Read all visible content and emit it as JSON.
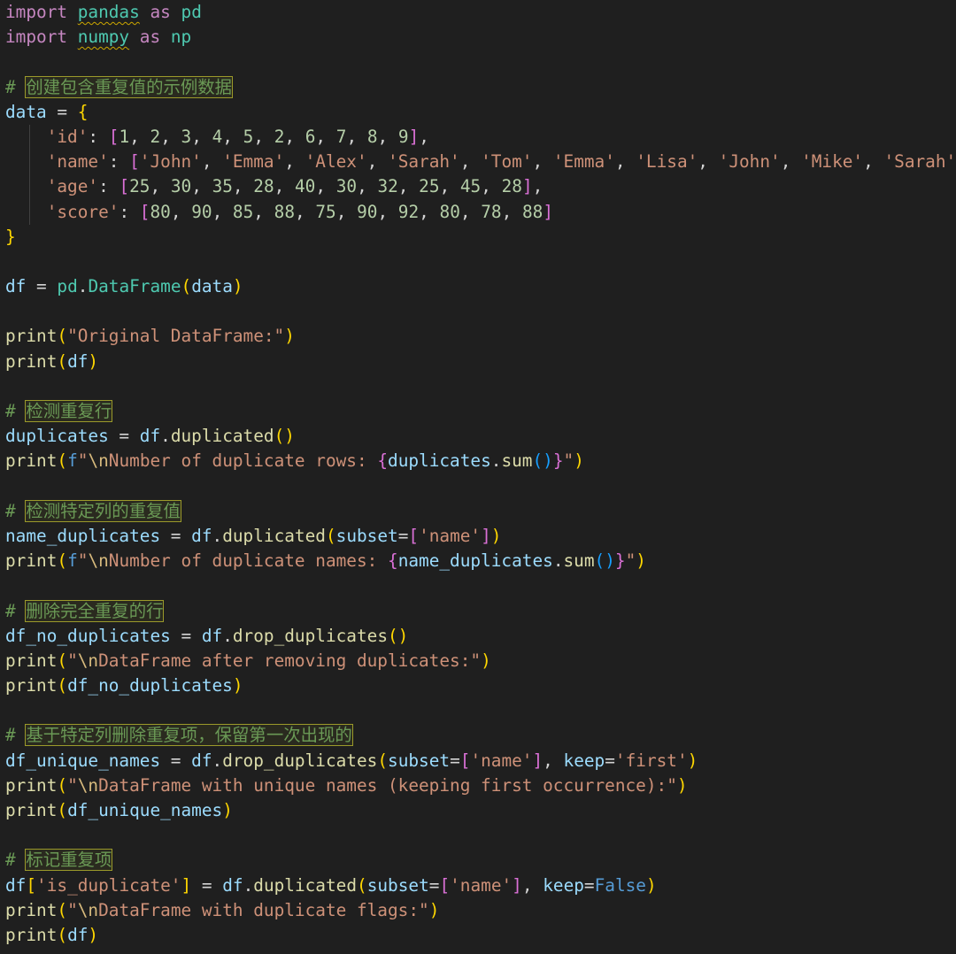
{
  "editor": {
    "language": "python",
    "theme_colors": {
      "background": "#1f1f1f",
      "keyword": "#c586c0",
      "variable": "#9cdcfe",
      "function": "#dcdcaa",
      "class": "#4ec9b0",
      "string": "#ce9178",
      "number": "#b5cea8",
      "comment": "#6a9955",
      "escape": "#d7ba7d",
      "constant": "#569cd6",
      "bracket_level1": "#ffd700",
      "bracket_level2": "#da70d6",
      "bracket_level3": "#179fff",
      "highlight_border": "#9b9a2a",
      "warning_squiggle": "#cca700"
    },
    "lines": [
      [
        [
          "kw",
          "import"
        ],
        [
          "t",
          " "
        ],
        [
          "mod squig",
          "pandas"
        ],
        [
          "t",
          " "
        ],
        [
          "kw",
          "as"
        ],
        [
          "t",
          " "
        ],
        [
          "mod",
          "pd"
        ]
      ],
      [
        [
          "kw",
          "import"
        ],
        [
          "t",
          " "
        ],
        [
          "mod squig",
          "numpy"
        ],
        [
          "t",
          " "
        ],
        [
          "kw",
          "as"
        ],
        [
          "t",
          " "
        ],
        [
          "mod",
          "np"
        ]
      ],
      [],
      [
        [
          "cm",
          "# "
        ],
        [
          "hl",
          "创建包含重复值的示例数据"
        ]
      ],
      [
        [
          "var",
          "data"
        ],
        [
          "t",
          " = "
        ],
        [
          "b1",
          "{"
        ]
      ],
      [
        [
          "t",
          "    "
        ],
        [
          "str",
          "'id'"
        ],
        [
          "t",
          ": "
        ],
        [
          "b2",
          "["
        ],
        [
          "num",
          "1"
        ],
        [
          "t",
          ", "
        ],
        [
          "num",
          "2"
        ],
        [
          "t",
          ", "
        ],
        [
          "num",
          "3"
        ],
        [
          "t",
          ", "
        ],
        [
          "num",
          "4"
        ],
        [
          "t",
          ", "
        ],
        [
          "num",
          "5"
        ],
        [
          "t",
          ", "
        ],
        [
          "num",
          "2"
        ],
        [
          "t",
          ", "
        ],
        [
          "num",
          "6"
        ],
        [
          "t",
          ", "
        ],
        [
          "num",
          "7"
        ],
        [
          "t",
          ", "
        ],
        [
          "num",
          "8"
        ],
        [
          "t",
          ", "
        ],
        [
          "num",
          "9"
        ],
        [
          "b2",
          "]"
        ],
        [
          "t",
          ","
        ]
      ],
      [
        [
          "t",
          "    "
        ],
        [
          "str",
          "'name'"
        ],
        [
          "t",
          ": "
        ],
        [
          "b2",
          "["
        ],
        [
          "str",
          "'John'"
        ],
        [
          "t",
          ", "
        ],
        [
          "str",
          "'Emma'"
        ],
        [
          "t",
          ", "
        ],
        [
          "str",
          "'Alex'"
        ],
        [
          "t",
          ", "
        ],
        [
          "str",
          "'Sarah'"
        ],
        [
          "t",
          ", "
        ],
        [
          "str",
          "'Tom'"
        ],
        [
          "t",
          ", "
        ],
        [
          "str",
          "'Emma'"
        ],
        [
          "t",
          ", "
        ],
        [
          "str",
          "'Lisa'"
        ],
        [
          "t",
          ", "
        ],
        [
          "str",
          "'John'"
        ],
        [
          "t",
          ", "
        ],
        [
          "str",
          "'Mike'"
        ],
        [
          "t",
          ", "
        ],
        [
          "str",
          "'Sarah'"
        ],
        [
          "b2",
          "]"
        ],
        [
          "t",
          ","
        ]
      ],
      [
        [
          "t",
          "    "
        ],
        [
          "str",
          "'age'"
        ],
        [
          "t",
          ": "
        ],
        [
          "b2",
          "["
        ],
        [
          "num",
          "25"
        ],
        [
          "t",
          ", "
        ],
        [
          "num",
          "30"
        ],
        [
          "t",
          ", "
        ],
        [
          "num",
          "35"
        ],
        [
          "t",
          ", "
        ],
        [
          "num",
          "28"
        ],
        [
          "t",
          ", "
        ],
        [
          "num",
          "40"
        ],
        [
          "t",
          ", "
        ],
        [
          "num",
          "30"
        ],
        [
          "t",
          ", "
        ],
        [
          "num",
          "32"
        ],
        [
          "t",
          ", "
        ],
        [
          "num",
          "25"
        ],
        [
          "t",
          ", "
        ],
        [
          "num",
          "45"
        ],
        [
          "t",
          ", "
        ],
        [
          "num",
          "28"
        ],
        [
          "b2",
          "]"
        ],
        [
          "t",
          ","
        ]
      ],
      [
        [
          "t",
          "    "
        ],
        [
          "str",
          "'score'"
        ],
        [
          "t",
          ": "
        ],
        [
          "b2",
          "["
        ],
        [
          "num",
          "80"
        ],
        [
          "t",
          ", "
        ],
        [
          "num",
          "90"
        ],
        [
          "t",
          ", "
        ],
        [
          "num",
          "85"
        ],
        [
          "t",
          ", "
        ],
        [
          "num",
          "88"
        ],
        [
          "t",
          ", "
        ],
        [
          "num",
          "75"
        ],
        [
          "t",
          ", "
        ],
        [
          "num",
          "90"
        ],
        [
          "t",
          ", "
        ],
        [
          "num",
          "92"
        ],
        [
          "t",
          ", "
        ],
        [
          "num",
          "80"
        ],
        [
          "t",
          ", "
        ],
        [
          "num",
          "78"
        ],
        [
          "t",
          ", "
        ],
        [
          "num",
          "88"
        ],
        [
          "b2",
          "]"
        ]
      ],
      [
        [
          "b1",
          "}"
        ]
      ],
      [],
      [
        [
          "var",
          "df"
        ],
        [
          "t",
          " = "
        ],
        [
          "mod",
          "pd"
        ],
        [
          "t",
          "."
        ],
        [
          "cls",
          "DataFrame"
        ],
        [
          "b1",
          "("
        ],
        [
          "var",
          "data"
        ],
        [
          "b1",
          ")"
        ]
      ],
      [],
      [
        [
          "fn",
          "print"
        ],
        [
          "b1",
          "("
        ],
        [
          "str",
          "\"Original DataFrame:\""
        ],
        [
          "b1",
          ")"
        ]
      ],
      [
        [
          "fn",
          "print"
        ],
        [
          "b1",
          "("
        ],
        [
          "var",
          "df"
        ],
        [
          "b1",
          ")"
        ]
      ],
      [],
      [
        [
          "cm",
          "# "
        ],
        [
          "hl",
          "检测重复行"
        ]
      ],
      [
        [
          "var",
          "duplicates"
        ],
        [
          "t",
          " = "
        ],
        [
          "var",
          "df"
        ],
        [
          "t",
          "."
        ],
        [
          "fn",
          "duplicated"
        ],
        [
          "b1",
          "()"
        ]
      ],
      [
        [
          "fn",
          "print"
        ],
        [
          "b1",
          "("
        ],
        [
          "const",
          "f"
        ],
        [
          "str",
          "\""
        ],
        [
          "esc",
          "\\n"
        ],
        [
          "str",
          "Number of duplicate rows: "
        ],
        [
          "b2",
          "{"
        ],
        [
          "var",
          "duplicates"
        ],
        [
          "t",
          "."
        ],
        [
          "fn",
          "sum"
        ],
        [
          "b3",
          "()"
        ],
        [
          "b2",
          "}"
        ],
        [
          "str",
          "\""
        ],
        [
          "b1",
          ")"
        ]
      ],
      [],
      [
        [
          "cm",
          "# "
        ],
        [
          "hl",
          "检测特定列的重复值"
        ]
      ],
      [
        [
          "var",
          "name_duplicates"
        ],
        [
          "t",
          " = "
        ],
        [
          "var",
          "df"
        ],
        [
          "t",
          "."
        ],
        [
          "fn",
          "duplicated"
        ],
        [
          "b1",
          "("
        ],
        [
          "var",
          "subset"
        ],
        [
          "t",
          "="
        ],
        [
          "b2",
          "["
        ],
        [
          "str",
          "'name'"
        ],
        [
          "b2",
          "]"
        ],
        [
          "b1",
          ")"
        ]
      ],
      [
        [
          "fn",
          "print"
        ],
        [
          "b1",
          "("
        ],
        [
          "const",
          "f"
        ],
        [
          "str",
          "\""
        ],
        [
          "esc",
          "\\n"
        ],
        [
          "str",
          "Number of duplicate names: "
        ],
        [
          "b2",
          "{"
        ],
        [
          "var",
          "name_duplicates"
        ],
        [
          "t",
          "."
        ],
        [
          "fn",
          "sum"
        ],
        [
          "b3",
          "()"
        ],
        [
          "b2",
          "}"
        ],
        [
          "str",
          "\""
        ],
        [
          "b1",
          ")"
        ]
      ],
      [],
      [
        [
          "cm",
          "# "
        ],
        [
          "hl",
          "删除完全重复的行"
        ]
      ],
      [
        [
          "var",
          "df_no_duplicates"
        ],
        [
          "t",
          " = "
        ],
        [
          "var",
          "df"
        ],
        [
          "t",
          "."
        ],
        [
          "fn",
          "drop_duplicates"
        ],
        [
          "b1",
          "()"
        ]
      ],
      [
        [
          "fn",
          "print"
        ],
        [
          "b1",
          "("
        ],
        [
          "str",
          "\""
        ],
        [
          "esc",
          "\\n"
        ],
        [
          "str",
          "DataFrame after removing duplicates:\""
        ],
        [
          "b1",
          ")"
        ]
      ],
      [
        [
          "fn",
          "print"
        ],
        [
          "b1",
          "("
        ],
        [
          "var",
          "df_no_duplicates"
        ],
        [
          "b1",
          ")"
        ]
      ],
      [],
      [
        [
          "cm",
          "# "
        ],
        [
          "hl",
          "基于特定列删除重复项，保留第一次出现的"
        ]
      ],
      [
        [
          "var",
          "df_unique_names"
        ],
        [
          "t",
          " = "
        ],
        [
          "var",
          "df"
        ],
        [
          "t",
          "."
        ],
        [
          "fn",
          "drop_duplicates"
        ],
        [
          "b1",
          "("
        ],
        [
          "var",
          "subset"
        ],
        [
          "t",
          "="
        ],
        [
          "b2",
          "["
        ],
        [
          "str",
          "'name'"
        ],
        [
          "b2",
          "]"
        ],
        [
          "t",
          ", "
        ],
        [
          "var",
          "keep"
        ],
        [
          "t",
          "="
        ],
        [
          "str",
          "'first'"
        ],
        [
          "b1",
          ")"
        ]
      ],
      [
        [
          "fn",
          "print"
        ],
        [
          "b1",
          "("
        ],
        [
          "str",
          "\""
        ],
        [
          "esc",
          "\\n"
        ],
        [
          "str",
          "DataFrame with unique names (keeping first occurrence):\""
        ],
        [
          "b1",
          ")"
        ]
      ],
      [
        [
          "fn",
          "print"
        ],
        [
          "b1",
          "("
        ],
        [
          "var",
          "df_unique_names"
        ],
        [
          "b1",
          ")"
        ]
      ],
      [],
      [
        [
          "cm",
          "# "
        ],
        [
          "hl",
          "标记重复项"
        ]
      ],
      [
        [
          "var",
          "df"
        ],
        [
          "b1",
          "["
        ],
        [
          "str",
          "'is_duplicate'"
        ],
        [
          "b1",
          "]"
        ],
        [
          "t",
          " = "
        ],
        [
          "var",
          "df"
        ],
        [
          "t",
          "."
        ],
        [
          "fn",
          "duplicated"
        ],
        [
          "b1",
          "("
        ],
        [
          "var",
          "subset"
        ],
        [
          "t",
          "="
        ],
        [
          "b2",
          "["
        ],
        [
          "str",
          "'name'"
        ],
        [
          "b2",
          "]"
        ],
        [
          "t",
          ", "
        ],
        [
          "var",
          "keep"
        ],
        [
          "t",
          "="
        ],
        [
          "const",
          "False"
        ],
        [
          "b1",
          ")"
        ]
      ],
      [
        [
          "fn",
          "print"
        ],
        [
          "b1",
          "("
        ],
        [
          "str",
          "\""
        ],
        [
          "esc",
          "\\n"
        ],
        [
          "str",
          "DataFrame with duplicate flags:\""
        ],
        [
          "b1",
          ")"
        ]
      ],
      [
        [
          "fn",
          "print"
        ],
        [
          "b1",
          "("
        ],
        [
          "var",
          "df"
        ],
        [
          "b1",
          ")"
        ]
      ]
    ]
  }
}
